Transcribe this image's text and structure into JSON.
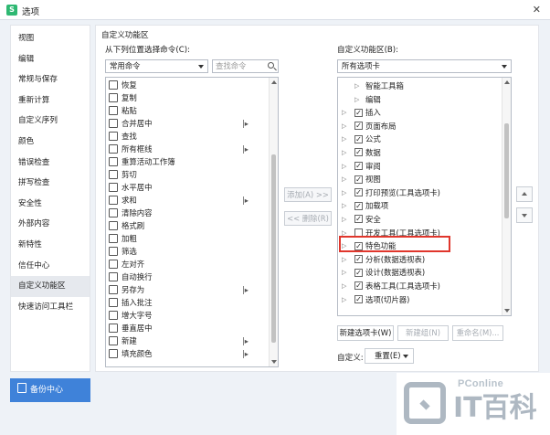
{
  "window": {
    "title": "选项",
    "app_icon": "S"
  },
  "sidebar": {
    "items": [
      "视图",
      "编辑",
      "常规与保存",
      "重新计算",
      "自定义序列",
      "颜色",
      "错误检查",
      "拼写检查",
      "安全性",
      "外部内容",
      "新特性",
      "信任中心",
      "自定义功能区",
      "快速访问工具栏"
    ],
    "active_index": 12
  },
  "backup_button": {
    "label": "备份中心"
  },
  "main": {
    "section_title": "自定义功能区",
    "choose_label": "从下列位置选择命令(C):",
    "choose_value": "常用命令",
    "search_placeholder": "查找命令",
    "commands": [
      {
        "label": "恢复",
        "has_sub": false
      },
      {
        "label": "复制",
        "has_sub": false
      },
      {
        "label": "粘贴",
        "has_sub": false
      },
      {
        "label": "合并居中",
        "has_sub": true
      },
      {
        "label": "查找",
        "has_sub": false
      },
      {
        "label": "所有框线",
        "has_sub": true
      },
      {
        "label": "重算活动工作簿",
        "has_sub": false
      },
      {
        "label": "剪切",
        "has_sub": false
      },
      {
        "label": "水平居中",
        "has_sub": false
      },
      {
        "label": "求和",
        "has_sub": true
      },
      {
        "label": "清除内容",
        "has_sub": false
      },
      {
        "label": "格式刷",
        "has_sub": false
      },
      {
        "label": "加粗",
        "has_sub": false
      },
      {
        "label": "筛选",
        "has_sub": false
      },
      {
        "label": "左对齐",
        "has_sub": false
      },
      {
        "label": "自动换行",
        "has_sub": false
      },
      {
        "label": "另存为",
        "has_sub": true
      },
      {
        "label": "插入批注",
        "has_sub": false
      },
      {
        "label": "增大字号",
        "has_sub": false
      },
      {
        "label": "垂直居中",
        "has_sub": false
      },
      {
        "label": "新建",
        "has_sub": true
      },
      {
        "label": "填充颜色",
        "has_sub": true
      }
    ],
    "add_button": "添加(A) >>",
    "remove_button": "<< 删除(R)",
    "ribbon_label": "自定义功能区(B):",
    "ribbon_value": "所有选项卡",
    "tabs": [
      {
        "label": "智能工具箱",
        "checked": false,
        "child": true,
        "has_cb": false
      },
      {
        "label": "编辑",
        "checked": false,
        "child": true,
        "has_cb": false
      },
      {
        "label": "插入",
        "checked": true,
        "child": false,
        "has_cb": true
      },
      {
        "label": "页面布局",
        "checked": true,
        "child": false,
        "has_cb": true
      },
      {
        "label": "公式",
        "checked": true,
        "child": false,
        "has_cb": true
      },
      {
        "label": "数据",
        "checked": true,
        "child": false,
        "has_cb": true
      },
      {
        "label": "审阅",
        "checked": true,
        "child": false,
        "has_cb": true
      },
      {
        "label": "视图",
        "checked": true,
        "child": false,
        "has_cb": true
      },
      {
        "label": "打印预览(工具选项卡)",
        "checked": true,
        "child": false,
        "has_cb": true
      },
      {
        "label": "加载项",
        "checked": true,
        "child": false,
        "has_cb": true
      },
      {
        "label": "安全",
        "checked": true,
        "child": false,
        "has_cb": true
      },
      {
        "label": "开发工具(工具选项卡)",
        "checked": false,
        "child": false,
        "has_cb": true
      },
      {
        "label": "特色功能",
        "checked": true,
        "child": false,
        "has_cb": true
      },
      {
        "label": "分析(数据透视表)",
        "checked": true,
        "child": false,
        "has_cb": true
      },
      {
        "label": "设计(数据透视表)",
        "checked": true,
        "child": false,
        "has_cb": true
      },
      {
        "label": "表格工具(工具选项卡)",
        "checked": true,
        "child": false,
        "has_cb": true
      },
      {
        "label": "选项(切片器)",
        "checked": true,
        "child": false,
        "has_cb": true
      }
    ],
    "new_tab_button": "新建选项卡(W)",
    "new_group_button": "新建组(N)",
    "rename_button": "重命名(M)...",
    "customize_label": "自定义:",
    "reset_button": "重置(E)"
  },
  "watermark": {
    "brand_small": "PConline",
    "brand_large": "IT百科"
  },
  "colors": {
    "accent": "#3f82d9",
    "highlight": "#e0362c"
  }
}
